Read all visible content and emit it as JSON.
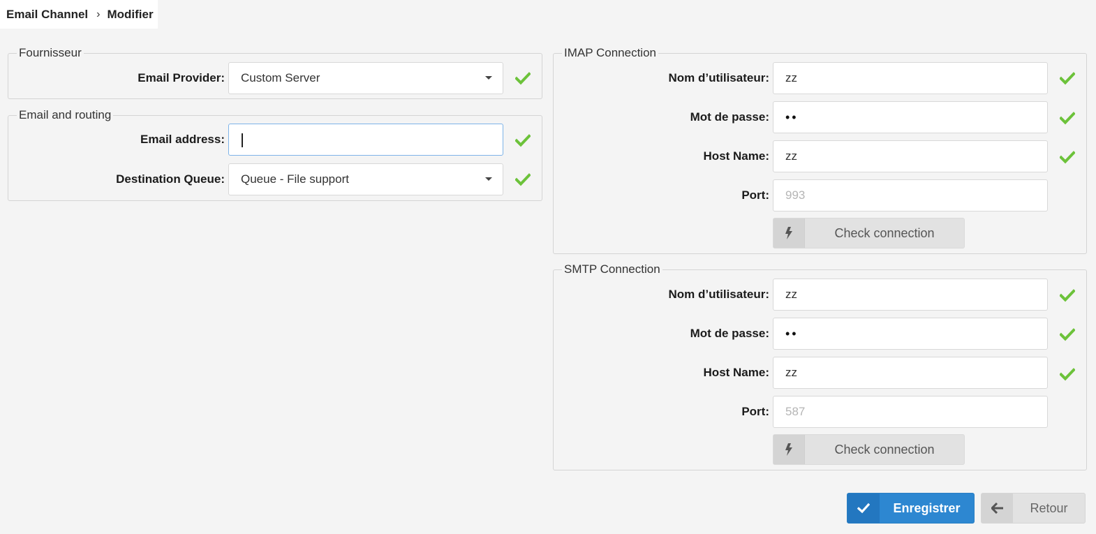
{
  "breadcrumb": {
    "parent": "Email Channel",
    "current": "Modifier",
    "separator": "›"
  },
  "provider_section": {
    "legend": "Fournisseur",
    "email_provider": {
      "label": "Email Provider:",
      "value": "Custom Server"
    }
  },
  "routing_section": {
    "legend": "Email and routing",
    "email_address": {
      "label": "Email address:",
      "value": ""
    },
    "destination_queue": {
      "label": "Destination Queue:",
      "value": "Queue - File support"
    }
  },
  "imap": {
    "legend": "IMAP Connection",
    "username": {
      "label": "Nom d’utilisateur:",
      "value": "zz"
    },
    "password": {
      "label": "Mot de passe:",
      "value": "••"
    },
    "host": {
      "label": "Host Name:",
      "value": "zz"
    },
    "port": {
      "label": "Port:",
      "placeholder": "993"
    },
    "check_button": "Check connection"
  },
  "smtp": {
    "legend": "SMTP Connection",
    "username": {
      "label": "Nom d’utilisateur:",
      "value": "zz"
    },
    "password": {
      "label": "Mot de passe:",
      "value": "••"
    },
    "host": {
      "label": "Host Name:",
      "value": "zz"
    },
    "port": {
      "label": "Port:",
      "placeholder": "587"
    },
    "check_button": "Check connection"
  },
  "actions": {
    "save": "Enregistrer",
    "back": "Retour"
  },
  "colors": {
    "primary": "#2d87d1",
    "valid_check": "#6cc23a",
    "focus_border": "#7db3e8"
  },
  "icons": {
    "valid": "check-icon",
    "check_connection": "bolt-icon",
    "save": "check-icon",
    "back": "arrow-left-icon",
    "select": "caret-down-icon"
  }
}
